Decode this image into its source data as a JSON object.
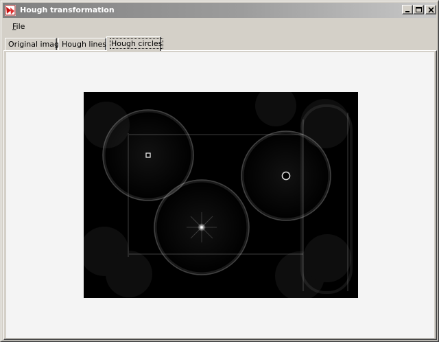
{
  "window": {
    "title": "Hough transformation",
    "icon": "app-icon",
    "controls": [
      "minimize-icon",
      "maximize-icon",
      "close-icon"
    ]
  },
  "menu": {
    "items": [
      {
        "label": "File",
        "accelerator": "F"
      }
    ]
  },
  "tabs": [
    {
      "label": "Original image",
      "selected": false
    },
    {
      "label": "Hough lines",
      "selected": false
    },
    {
      "label": "Hough circles",
      "selected": true
    }
  ],
  "accumulator": {
    "background": "#000000",
    "circle_color": "#ffffff",
    "circles": [
      {
        "center": "small bright square peak",
        "radius_class": "large"
      },
      {
        "center": "ring peak",
        "radius_class": "large"
      },
      {
        "center": "bright point peak",
        "radius_class": "large"
      }
    ]
  }
}
